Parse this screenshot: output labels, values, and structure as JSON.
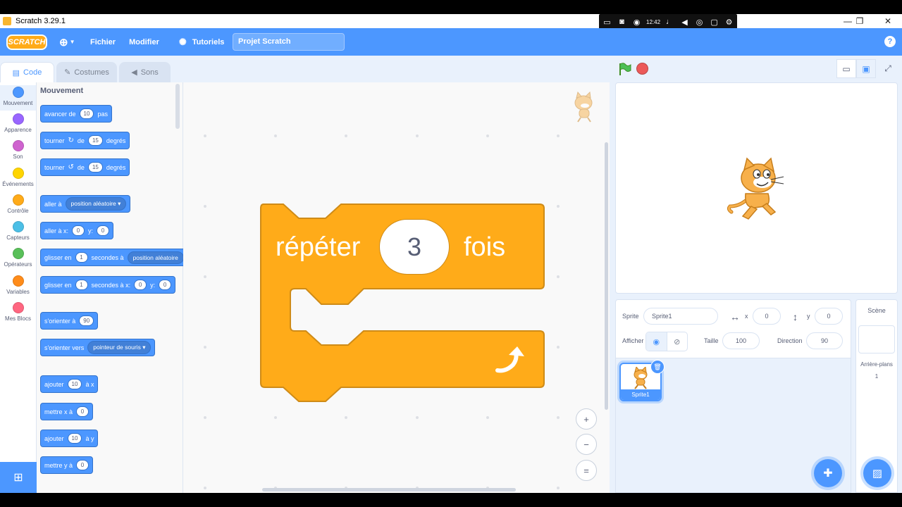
{
  "window": {
    "title": "Scratch 3.29.1",
    "minimize": "—",
    "maximize": "❐",
    "close": "✕"
  },
  "recorder": {
    "time": "12:42"
  },
  "menubar": {
    "logo": "SCRATCH",
    "language_icon": "globe-icon",
    "file": "Fichier",
    "edit": "Modifier",
    "tutorials": "Tutoriels",
    "project_title": "Projet Scratch",
    "help": "?"
  },
  "tabs": {
    "code": "Code",
    "costumes": "Costumes",
    "sounds": "Sons"
  },
  "categories": [
    {
      "label": "Mouvement",
      "color": "#4c97ff"
    },
    {
      "label": "Apparence",
      "color": "#9966ff"
    },
    {
      "label": "Son",
      "color": "#cf63cf"
    },
    {
      "label": "Événements",
      "color": "#ffd500"
    },
    {
      "label": "Contrôle",
      "color": "#ffab19"
    },
    {
      "label": "Capteurs",
      "color": "#4cbfe6"
    },
    {
      "label": "Opérateurs",
      "color": "#59c059"
    },
    {
      "label": "Variables",
      "color": "#ff8c1a"
    },
    {
      "label": "Mes Blocs",
      "color": "#ff6680"
    }
  ],
  "palette": {
    "heading": "Mouvement",
    "blocks": {
      "move": {
        "t1": "avancer de",
        "v1": "10",
        "t2": "pas"
      },
      "turn_right": {
        "t1": "tourner",
        "t2": "de",
        "v1": "15",
        "t3": "degrés"
      },
      "turn_left": {
        "t1": "tourner",
        "t2": "de",
        "v1": "15",
        "t3": "degrés"
      },
      "goto": {
        "t1": "aller à",
        "dd": "position aléatoire"
      },
      "goto_xy": {
        "t1": "aller à x:",
        "v1": "0",
        "t2": "y:",
        "v2": "0"
      },
      "glide_to": {
        "t1": "glisser en",
        "v1": "1",
        "t2": "secondes à",
        "dd": "position aléatoire"
      },
      "glide_xy": {
        "t1": "glisser en",
        "v1": "1",
        "t2": "secondes à x:",
        "v2": "0",
        "t3": "y:",
        "v3": "0"
      },
      "point_dir": {
        "t1": "s'orienter à",
        "v1": "90"
      },
      "point_towards": {
        "t1": "s'orienter vers",
        "dd": "pointeur de souris"
      },
      "change_x": {
        "t1": "ajouter",
        "v1": "10",
        "t2": "à x"
      },
      "set_x": {
        "t1": "mettre x à",
        "v1": "0"
      },
      "change_y": {
        "t1": "ajouter",
        "v1": "10",
        "t2": "à y"
      },
      "set_y": {
        "t1": "mettre y à",
        "v1": "0"
      }
    }
  },
  "workspace": {
    "repeat_block": {
      "label": "répéter",
      "value": "3",
      "suffix": "fois",
      "color": "#ffab19"
    }
  },
  "stage_controls": {
    "zoom_in": "+",
    "zoom_out": "−",
    "zoom_reset": "="
  },
  "sprite_info": {
    "sprite_label": "Sprite",
    "sprite_name": "Sprite1",
    "x_label": "x",
    "x_value": "0",
    "y_label": "y",
    "y_value": "0",
    "show_label": "Afficher",
    "size_label": "Taille",
    "size_value": "100",
    "direction_label": "Direction",
    "direction_value": "90"
  },
  "sprite_list": {
    "items": [
      {
        "name": "Sprite1"
      }
    ]
  },
  "stage_pane": {
    "title": "Scène",
    "backdrops_label": "Arrière-plans",
    "backdrops_count": "1"
  }
}
